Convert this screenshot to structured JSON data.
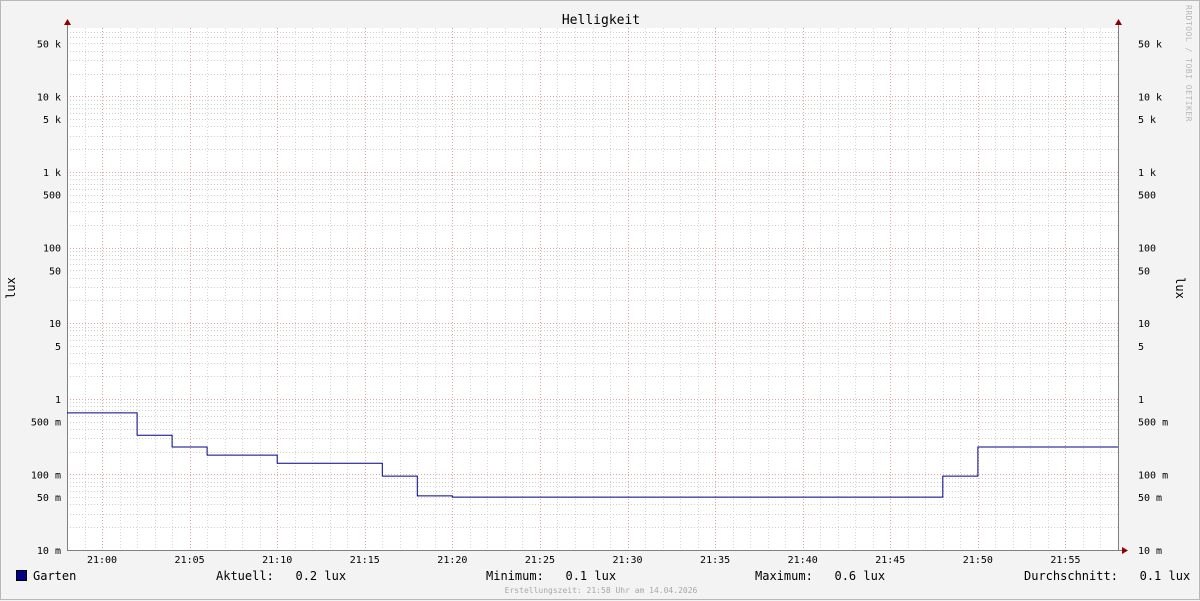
{
  "chart_data": {
    "type": "line",
    "title": "Helligkeit",
    "ylabel": "lux",
    "y_scale": "log",
    "ylim": [
      10,
      80000
    ],
    "x_domain_minutes": [
      "20:58",
      "21:58"
    ],
    "x_ticks": [
      "21:00",
      "21:05",
      "21:10",
      "21:15",
      "21:20",
      "21:25",
      "21:30",
      "21:35",
      "21:40",
      "21:45",
      "21:50",
      "21:55"
    ],
    "y_ticks": [
      {
        "value": 50000,
        "label": "50 k"
      },
      {
        "value": 10000,
        "label": "10 k"
      },
      {
        "value": 5000,
        "label": "5 k"
      },
      {
        "value": 1000,
        "label": "1 k"
      },
      {
        "value": 500,
        "label": "500"
      },
      {
        "value": 100,
        "label": "100"
      },
      {
        "value": 50,
        "label": "50"
      },
      {
        "value": 10,
        "label": "10"
      },
      {
        "value": 5,
        "label": "5"
      },
      {
        "value": 1,
        "label": "1"
      },
      {
        "value": 0.5,
        "label": "500 m"
      },
      {
        "value": 0.1,
        "label": "100 m"
      },
      {
        "value": 0.05,
        "label": "50 m"
      },
      {
        "value": 0.01,
        "label": "10 m"
      }
    ],
    "series": [
      {
        "name": "Garten",
        "color": "#00008b",
        "step": true,
        "points": [
          {
            "x": "20:58",
            "y": 0.65
          },
          {
            "x": "21:02",
            "y": 0.33
          },
          {
            "x": "21:04",
            "y": 0.23
          },
          {
            "x": "21:06",
            "y": 0.18
          },
          {
            "x": "21:10",
            "y": 0.14
          },
          {
            "x": "21:16",
            "y": 0.095
          },
          {
            "x": "21:18",
            "y": 0.052
          },
          {
            "x": "21:20",
            "y": 0.05
          },
          {
            "x": "21:48",
            "y": 0.095
          },
          {
            "x": "21:50",
            "y": 0.23
          },
          {
            "x": "21:58",
            "y": 0.23
          }
        ]
      }
    ],
    "grid": true
  },
  "legend": {
    "series_name": "Garten",
    "aktuell_label": "Aktuell:",
    "aktuell_value": "0.2 lux",
    "minimum_label": "Minimum:",
    "minimum_value": "0.1 lux",
    "maximum_label": "Maximum:",
    "maximum_value": "0.6 lux",
    "durchschnitt_label": "Durchschnitt:",
    "durchschnitt_value": "0.1 lux"
  },
  "footer": "Erstellungszeit: 21:58 Uhr am 14.04.2026",
  "watermark": "RRDTOOL / TOBI OETIKER",
  "colors": {
    "line": "#00008b",
    "major_grid": "#e5a0a0",
    "minor_grid": "#c8c8c8"
  }
}
